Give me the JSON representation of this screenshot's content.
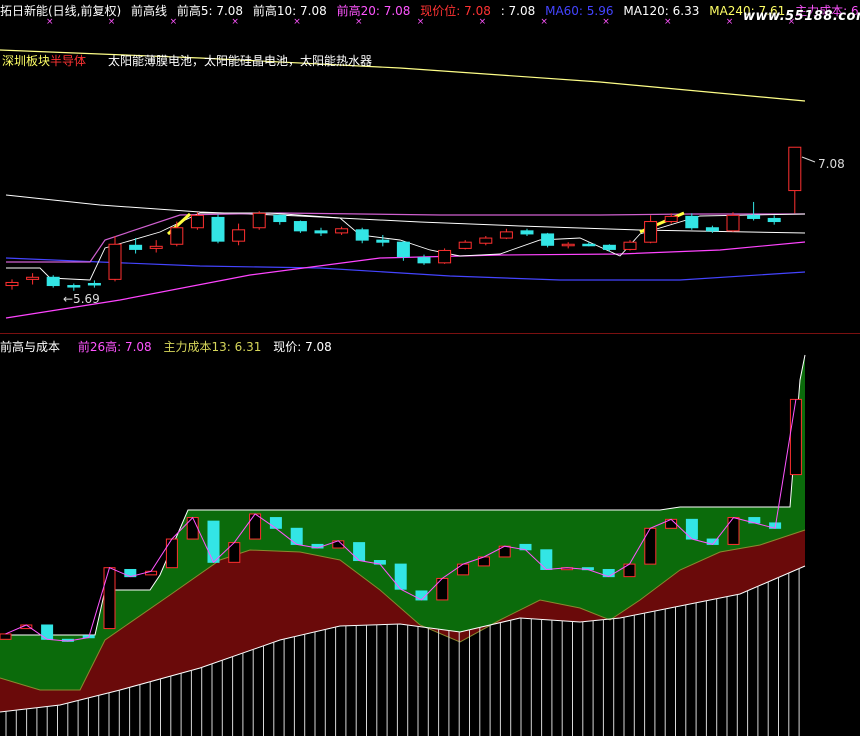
{
  "header": {
    "stock": "拓日新能(日线,前复权)",
    "indicator": "前高线",
    "items": [
      {
        "label": "前高5: 7.08",
        "color": "#ffffff"
      },
      {
        "label": "前高10: 7.08",
        "color": "#ffffff"
      },
      {
        "label": "前高20: 7.08",
        "color": "#ff55ff"
      },
      {
        "label": "现价位: 7.08",
        "color": "#ff3333"
      },
      {
        "label": ": 7.08",
        "color": "#ffffff"
      },
      {
        "label": "MA60: 5.96",
        "color": "#4444ff"
      },
      {
        "label": "MA120: 6.33",
        "color": "#ffffff"
      },
      {
        "label": "MA240: 7.61",
        "color": "#ffff66"
      },
      {
        "label": "主力成本: 6.23",
        "color": "#ff55ff"
      }
    ],
    "watermark": "www.55188.com"
  },
  "sector": {
    "market": "深圳板块",
    "sector": "半导体",
    "concepts": "太阳能薄膜电池，太阳能硅晶电池，太阳能热水器"
  },
  "annotations": {
    "low": "←5.69",
    "high": "7.08"
  },
  "indicator_panel": {
    "title": "前高与成本",
    "items": [
      {
        "label": "前26高: 7.08",
        "color": "#ff55ff"
      },
      {
        "label": "主力成本13: 6.31",
        "color": "#d6d65a"
      },
      {
        "label": "现价: 7.08",
        "color": "#ffffff"
      }
    ]
  },
  "colors": {
    "up": "#ff3030",
    "down": "#33e5e5",
    "ma60": "#4444ff",
    "ma120": "#ffffff",
    "ma240": "#ffff88",
    "cost": "#ff44ff",
    "high20": "#d060d0",
    "fill_green": "#0b6b0b",
    "fill_red": "#6a0a0a"
  },
  "chart_data": {
    "type": "candlestick",
    "candles": [
      {
        "o": 5.74,
        "h": 5.8,
        "l": 5.7,
        "c": 5.77
      },
      {
        "o": 5.8,
        "h": 5.86,
        "l": 5.75,
        "c": 5.82
      },
      {
        "o": 5.82,
        "h": 5.84,
        "l": 5.72,
        "c": 5.74
      },
      {
        "o": 5.74,
        "h": 5.76,
        "l": 5.69,
        "c": 5.73
      },
      {
        "o": 5.76,
        "h": 5.79,
        "l": 5.72,
        "c": 5.75
      },
      {
        "o": 5.8,
        "h": 6.22,
        "l": 5.78,
        "c": 6.14
      },
      {
        "o": 6.13,
        "h": 6.2,
        "l": 6.05,
        "c": 6.09
      },
      {
        "o": 6.1,
        "h": 6.18,
        "l": 6.06,
        "c": 6.12
      },
      {
        "o": 6.14,
        "h": 6.36,
        "l": 6.12,
        "c": 6.3
      },
      {
        "o": 6.3,
        "h": 6.45,
        "l": 6.28,
        "c": 6.42
      },
      {
        "o": 6.4,
        "h": 6.43,
        "l": 6.15,
        "c": 6.17
      },
      {
        "o": 6.17,
        "h": 6.34,
        "l": 6.13,
        "c": 6.28
      },
      {
        "o": 6.3,
        "h": 6.46,
        "l": 6.28,
        "c": 6.44
      },
      {
        "o": 6.42,
        "h": 6.43,
        "l": 6.33,
        "c": 6.36
      },
      {
        "o": 6.36,
        "h": 6.37,
        "l": 6.25,
        "c": 6.27
      },
      {
        "o": 6.27,
        "h": 6.3,
        "l": 6.22,
        "c": 6.25
      },
      {
        "o": 6.25,
        "h": 6.31,
        "l": 6.23,
        "c": 6.29
      },
      {
        "o": 6.28,
        "h": 6.3,
        "l": 6.15,
        "c": 6.18
      },
      {
        "o": 6.18,
        "h": 6.23,
        "l": 6.12,
        "c": 6.16
      },
      {
        "o": 6.16,
        "h": 6.17,
        "l": 5.98,
        "c": 6.02
      },
      {
        "o": 6.01,
        "h": 6.04,
        "l": 5.94,
        "c": 5.96
      },
      {
        "o": 5.96,
        "h": 6.1,
        "l": 5.95,
        "c": 6.08
      },
      {
        "o": 6.1,
        "h": 6.18,
        "l": 6.09,
        "c": 6.16
      },
      {
        "o": 6.15,
        "h": 6.22,
        "l": 6.13,
        "c": 6.2
      },
      {
        "o": 6.2,
        "h": 6.29,
        "l": 6.19,
        "c": 6.26
      },
      {
        "o": 6.27,
        "h": 6.29,
        "l": 6.22,
        "c": 6.24
      },
      {
        "o": 6.24,
        "h": 6.25,
        "l": 6.11,
        "c": 6.13
      },
      {
        "o": 6.13,
        "h": 6.16,
        "l": 6.1,
        "c": 6.14
      },
      {
        "o": 6.14,
        "h": 6.16,
        "l": 6.12,
        "c": 6.13
      },
      {
        "o": 6.13,
        "h": 6.14,
        "l": 6.07,
        "c": 6.09
      },
      {
        "o": 6.09,
        "h": 6.18,
        "l": 6.08,
        "c": 6.16
      },
      {
        "o": 6.16,
        "h": 6.42,
        "l": 6.15,
        "c": 6.36
      },
      {
        "o": 6.36,
        "h": 6.44,
        "l": 6.34,
        "c": 6.41
      },
      {
        "o": 6.41,
        "h": 6.44,
        "l": 6.28,
        "c": 6.3
      },
      {
        "o": 6.3,
        "h": 6.32,
        "l": 6.25,
        "c": 6.27
      },
      {
        "o": 6.27,
        "h": 6.45,
        "l": 6.26,
        "c": 6.42
      },
      {
        "o": 6.42,
        "h": 6.55,
        "l": 6.37,
        "c": 6.39
      },
      {
        "o": 6.39,
        "h": 6.42,
        "l": 6.33,
        "c": 6.36
      },
      {
        "o": 6.66,
        "h": 7.08,
        "l": 6.44,
        "c": 7.08
      }
    ],
    "y_range": [
      5.6,
      7.15
    ]
  }
}
